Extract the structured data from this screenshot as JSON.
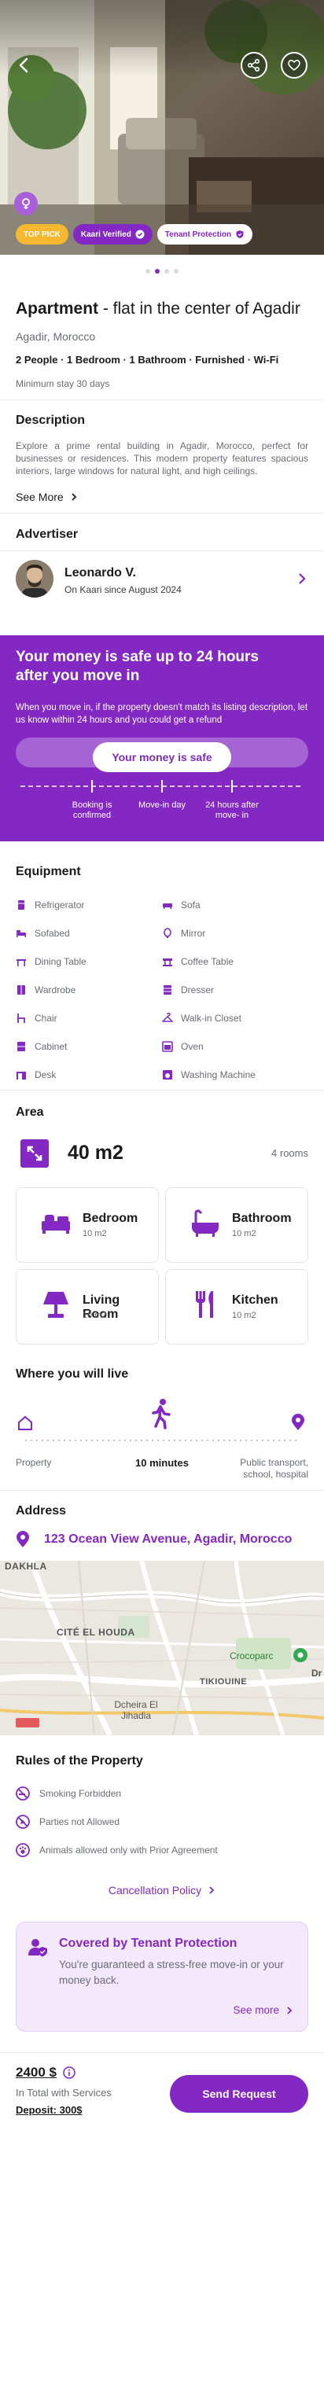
{
  "badges": {
    "top_pick": "TOP PICK",
    "verified": "Kaari Verified",
    "tenant_protection": "Tenant Protection"
  },
  "listing": {
    "type": "Apartment",
    "title_rest": " - flat in the center of Agadir",
    "location": "Agadir, Morocco",
    "features": "2 People · 1 Bedroom · 1 Bathroom · Furnished · Wi-Fi",
    "min_stay": "Minimum stay 30 days"
  },
  "description": {
    "heading": "Description",
    "text": "Explore a prime rental building in Agadir, Morocco, perfect for businesses or residences. This modern property features spacious interiors, large windows for natural light, and high ceilings.",
    "see_more": "See More"
  },
  "advertiser": {
    "heading": "Advertiser",
    "name": "Leonardo V.",
    "since": "On Kaari since August 2024"
  },
  "money": {
    "title": "Your money is safe up to 24 hours after you move in",
    "text": "When you move in, if the property doesn't match its listing description, let us know within 24 hours and you could get a refund",
    "button": "Your money is safe",
    "steps": [
      "Booking is confirmed",
      "Move-in day",
      "24 hours after move- in"
    ]
  },
  "equipment": {
    "heading": "Equipment",
    "items": [
      {
        "label": "Refrigerator",
        "icon": "refrigerator-icon"
      },
      {
        "label": "Sofa",
        "icon": "sofa-icon"
      },
      {
        "label": "Sofabed",
        "icon": "sofabed-icon"
      },
      {
        "label": "Mirror",
        "icon": "mirror-icon"
      },
      {
        "label": "Dining Table",
        "icon": "dining-table-icon"
      },
      {
        "label": "Coffee Table",
        "icon": "coffee-table-icon"
      },
      {
        "label": "Wardrobe",
        "icon": "wardrobe-icon"
      },
      {
        "label": "Dresser",
        "icon": "dresser-icon"
      },
      {
        "label": "Chair",
        "icon": "chair-icon"
      },
      {
        "label": "Walk-in Closet",
        "icon": "walk-in-closet-icon"
      },
      {
        "label": "Cabinet",
        "icon": "cabinet-icon"
      },
      {
        "label": "Oven",
        "icon": "oven-icon"
      },
      {
        "label": "Desk",
        "icon": "desk-icon"
      },
      {
        "label": "Washing Machine",
        "icon": "washing-machine-icon"
      }
    ]
  },
  "area": {
    "heading": "Area",
    "size": "40 m2",
    "rooms_count": "4 rooms",
    "rooms": [
      {
        "name": "Bedroom",
        "size": "10 m2",
        "icon": "bed-icon"
      },
      {
        "name": "Bathroom",
        "size": "10 m2",
        "icon": "bathtub-icon"
      },
      {
        "name": "Living Room",
        "size": "10 m2",
        "icon": "lamp-icon"
      },
      {
        "name": "Kitchen",
        "size": "10 m2",
        "icon": "cutlery-icon"
      }
    ]
  },
  "live": {
    "heading": "Where you will live",
    "property": "Property",
    "duration": "10 minutes",
    "destination": "Public transport, school, hospital"
  },
  "address": {
    "heading": "Address",
    "value": "123 Ocean View Avenue, Agadir, Morocco",
    "map_labels": [
      "DAKHLA",
      "CITÉ EL HOUDA",
      "Crocoparc",
      "TIKIOUINE",
      "Dcheira El Jihadia",
      "Dr"
    ]
  },
  "rules": {
    "heading": "Rules of the Property",
    "items": [
      "Smoking Forbidden",
      "Parties not Allowed",
      "Animals allowed only with Prior Agreement"
    ],
    "cancellation": "Cancellation Policy"
  },
  "tenant": {
    "title": "Covered by Tenant Protection",
    "text": "You're guaranteed a stress-free move-in or your money back.",
    "link": "See more"
  },
  "footer": {
    "price": "2400 $",
    "price_note": "In Total with Services",
    "deposit": "Deposit: 300$",
    "button": "Send Request"
  },
  "colors": {
    "accent": "#8428c4",
    "gold": "#f5b82e"
  }
}
